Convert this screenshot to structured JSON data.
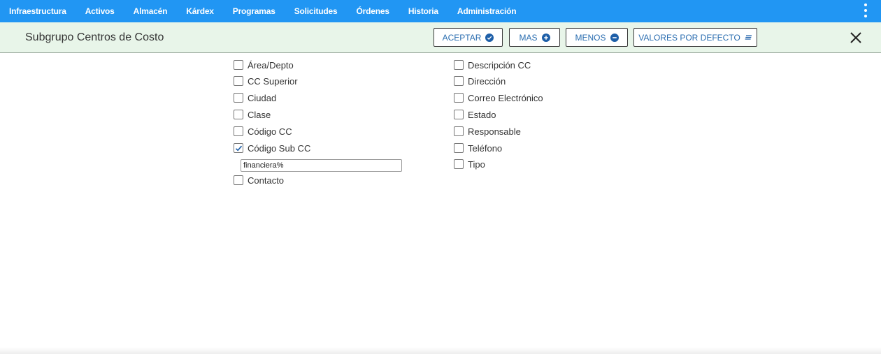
{
  "nav": {
    "items": [
      "Infraestructura",
      "Activos",
      "Almacén",
      "Kárdex",
      "Programas",
      "Solicitudes",
      "Órdenes",
      "Historia",
      "Administración"
    ]
  },
  "header": {
    "title": "Subgrupo Centros de Costo",
    "buttons": {
      "accept": "ACEPTAR",
      "more": "MAS",
      "less": "MENOS",
      "defaults": "VALORES POR DEFECTO"
    }
  },
  "fields": {
    "left": [
      {
        "label": "Área/Depto",
        "checked": false
      },
      {
        "label": "CC Superior",
        "checked": false
      },
      {
        "label": "Ciudad",
        "checked": false
      },
      {
        "label": "Clase",
        "checked": false
      },
      {
        "label": "Código CC",
        "checked": false
      },
      {
        "label": "Código Sub CC",
        "checked": true
      },
      {
        "label": "Contacto",
        "checked": false
      }
    ],
    "right": [
      {
        "label": "Descripción CC",
        "checked": false
      },
      {
        "label": "Dirección",
        "checked": false
      },
      {
        "label": "Correo Electrónico",
        "checked": false
      },
      {
        "label": "Estado",
        "checked": false
      },
      {
        "label": "Responsable",
        "checked": false
      },
      {
        "label": "Teléfono",
        "checked": false
      },
      {
        "label": "Tipo",
        "checked": false
      }
    ]
  },
  "filter": {
    "value": "financiera%"
  },
  "colors": {
    "nav_bg": "#2196f3",
    "subbar_bg": "#e8f5e9",
    "button_text": "#2a6db0",
    "check": "#1e5fa8"
  }
}
